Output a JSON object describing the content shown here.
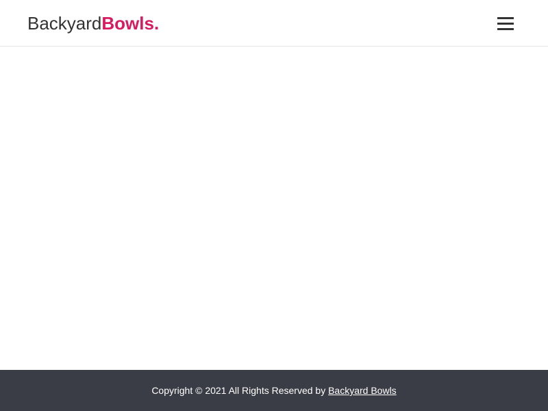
{
  "header": {
    "logo_text_regular": "Backyard",
    "logo_text_bold": "Bowls."
  },
  "icons": {
    "menu": "hamburger-menu-icon"
  },
  "colors": {
    "brand_accent": "#d81b60",
    "text_dark": "#333333",
    "footer_bg": "#3a3d45",
    "footer_text": "#ffffff"
  },
  "footer": {
    "copyright_text": "Copyright © 2021 All Rights Reserved by ",
    "link_label": "Backyard Bowls"
  }
}
